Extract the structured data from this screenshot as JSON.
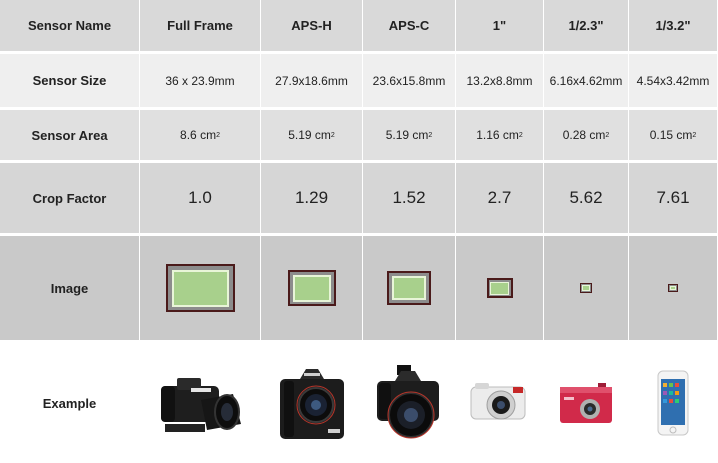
{
  "header": {
    "label": "Sensor Name",
    "columns": [
      "Full Frame",
      "APS-H",
      "APS-C",
      "1\"",
      "1/2.3\"",
      "1/3.2\""
    ]
  },
  "rows": {
    "size": {
      "label": "Sensor Size",
      "values": [
        "36 x 23.9mm",
        "27.9x18.6mm",
        "23.6x15.8mm",
        "13.2x8.8mm",
        "6.16x4.62mm",
        "4.54x3.42mm"
      ]
    },
    "area": {
      "label": "Sensor Area",
      "unit": "cm",
      "unit_exp": "2",
      "values": [
        "8.6",
        "5.19",
        "5.19",
        "1.16",
        "0.28",
        "0.15"
      ]
    },
    "crop": {
      "label": "Crop Factor",
      "values": [
        "1.0",
        "1.29",
        "1.52",
        "2.7",
        "5.62",
        "7.61"
      ]
    },
    "image": {
      "label": "Image"
    },
    "example": {
      "label": "Example"
    }
  },
  "colors": {
    "sensor_outer": "#8c8c8c",
    "sensor_border": "#4a1a1a",
    "sensor_inner": "#a8d08c",
    "sensor_inner_border": "#e8f5d8"
  },
  "example_icons": [
    "dslr-camera-icon",
    "pro-dslr-camera-icon",
    "dslr-camera-icon",
    "mirrorless-camera-icon",
    "compact-camera-icon",
    "smartphone-icon"
  ]
}
